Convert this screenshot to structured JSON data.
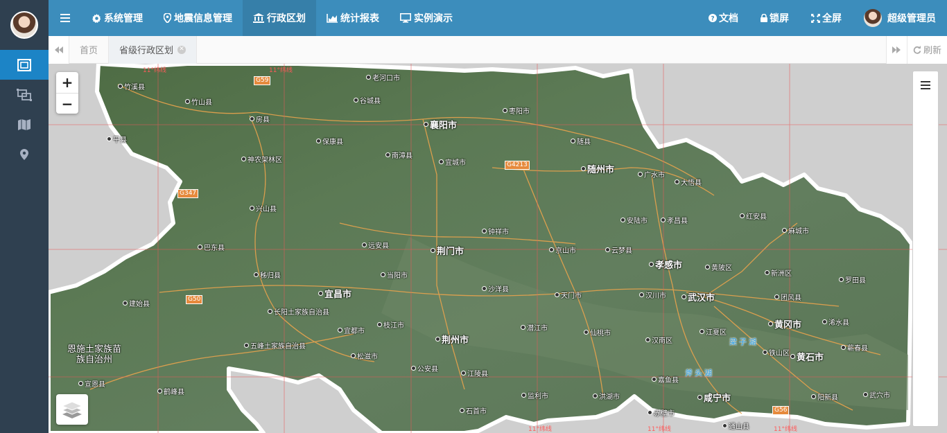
{
  "topbar": {
    "menu_items": [
      {
        "label": "系统管理",
        "icon": "gear-icon"
      },
      {
        "label": "地震信息管理",
        "icon": "map-marker-icon"
      },
      {
        "label": "行政区划",
        "icon": "institution-icon"
      },
      {
        "label": "统计报表",
        "icon": "area-chart-icon"
      },
      {
        "label": "实例演示",
        "icon": "desktop-icon"
      }
    ],
    "active_menu": "行政区划",
    "right_items": [
      {
        "label": "文档",
        "icon": "question-circle-icon"
      },
      {
        "label": "锁屏",
        "icon": "lock-icon"
      },
      {
        "label": "全屏",
        "icon": "expand-icon"
      }
    ],
    "user_name": "超级管理员",
    "colors": {
      "topbar": "#3c8dbc",
      "active": "#367fa9",
      "sidebar": "#2f4050",
      "sidebar_active": "#1c84c6"
    }
  },
  "sidebar": {
    "items": [
      {
        "icon": "object-group-icon",
        "active": true
      },
      {
        "icon": "object-ungroup-icon",
        "active": false
      },
      {
        "icon": "map-icon",
        "active": false
      },
      {
        "icon": "map-pin-icon",
        "active": false
      }
    ]
  },
  "tabs": {
    "items": [
      {
        "label": "首页",
        "active": false
      },
      {
        "label": "省级行政区划",
        "active": true
      }
    ],
    "refresh_label": "刷新"
  },
  "map": {
    "zoom_in": "+",
    "zoom_out": "−",
    "cities": [
      {
        "name": "竹溪县"
      },
      {
        "name": "竹山县"
      },
      {
        "name": "房县"
      },
      {
        "name": "老河口市"
      },
      {
        "name": "谷城县"
      },
      {
        "name": "襄阳市"
      },
      {
        "name": "枣阳市"
      },
      {
        "name": "保康县"
      },
      {
        "name": "南漳县"
      },
      {
        "name": "宜城市"
      },
      {
        "name": "随县"
      },
      {
        "name": "随州市"
      },
      {
        "name": "神农架林区"
      },
      {
        "name": "广水市"
      },
      {
        "name": "大悟县"
      },
      {
        "name": "兴山县"
      },
      {
        "name": "钟祥市"
      },
      {
        "name": "安陆市"
      },
      {
        "name": "孝昌县"
      },
      {
        "name": "红安县"
      },
      {
        "name": "麻城市"
      },
      {
        "name": "巴东县"
      },
      {
        "name": "远安县"
      },
      {
        "name": "荆门市"
      },
      {
        "name": "京山市"
      },
      {
        "name": "云梦县"
      },
      {
        "name": "孝感市"
      },
      {
        "name": "黄陂区"
      },
      {
        "name": "新洲区"
      },
      {
        "name": "秭归县"
      },
      {
        "name": "当阳市"
      },
      {
        "name": "宜昌市"
      },
      {
        "name": "沙洋县"
      },
      {
        "name": "天门市"
      },
      {
        "name": "汉川市"
      },
      {
        "name": "武汉市"
      },
      {
        "name": "团风县"
      },
      {
        "name": "罗田县"
      },
      {
        "name": "建始县"
      },
      {
        "name": "长阳土家族自治县"
      },
      {
        "name": "宜都市"
      },
      {
        "name": "枝江市"
      },
      {
        "name": "潜江市"
      },
      {
        "name": "黄冈市"
      },
      {
        "name": "浠水县"
      },
      {
        "name": "荆州市"
      },
      {
        "name": "仙桃市"
      },
      {
        "name": "江夏区"
      },
      {
        "name": "汉南区"
      },
      {
        "name": "鄂州市"
      },
      {
        "name": "五峰土家族自治县"
      },
      {
        "name": "恩施土家族苗族自治州"
      },
      {
        "name": "松滋市"
      },
      {
        "name": "铁山区"
      },
      {
        "name": "黄石市"
      },
      {
        "name": "蕲春县"
      },
      {
        "name": "公安县"
      },
      {
        "name": "江陵县"
      },
      {
        "name": "宣恩县"
      },
      {
        "name": "鹤峰县"
      },
      {
        "name": "嘉鱼县"
      },
      {
        "name": "监利市"
      },
      {
        "name": "洪湖市"
      },
      {
        "name": "咸宁市"
      },
      {
        "name": "阳新县"
      },
      {
        "name": "石首市"
      },
      {
        "name": "赤壁市"
      },
      {
        "name": "通山县"
      },
      {
        "name": "平县"
      },
      {
        "name": "武穴市"
      }
    ],
    "lakes": [
      {
        "name": "梁子湖"
      },
      {
        "name": "斧头湖"
      }
    ],
    "roads": [
      "G59",
      "G4213",
      "G347",
      "G50",
      "G56"
    ],
    "grid_labels": [
      "11°纬线",
      "11°纬线",
      "11°纬线",
      "11°纬线",
      "11°纬线"
    ]
  }
}
